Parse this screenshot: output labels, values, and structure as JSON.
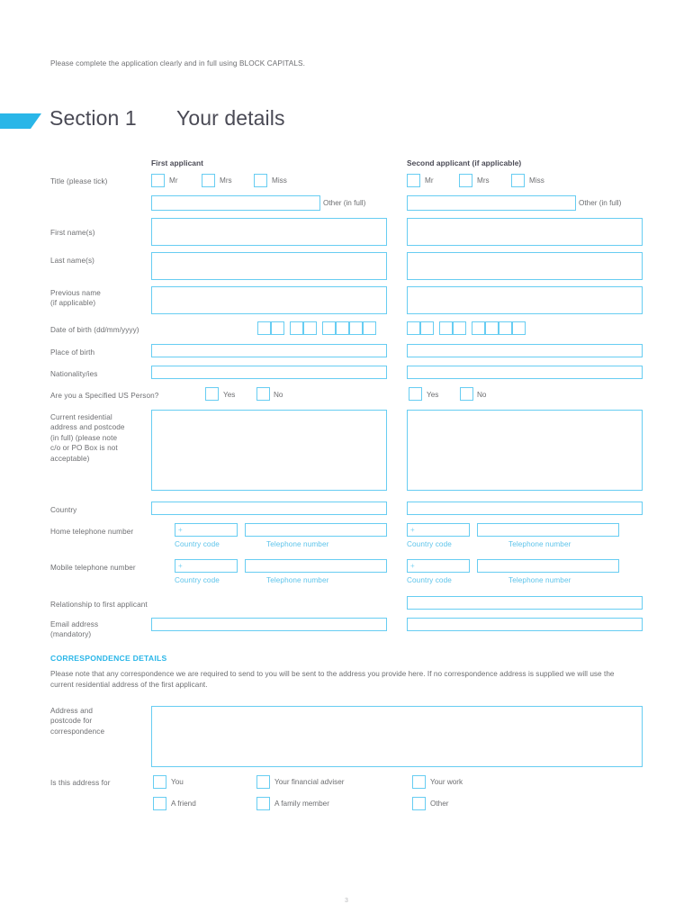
{
  "intro": {
    "text": "Please complete the application clearly and in full using BLOCK CAPITALS."
  },
  "section": {
    "number_label": "Section 1",
    "title": "Your details",
    "accent_color": "#29b6e8"
  },
  "colors": {
    "accent": "#29b6e8",
    "field_border": "#67cdf2",
    "sub_label": "#5cc3ea",
    "body_text": "#6d6e71",
    "heading_text": "#4a4a55"
  },
  "columns": {
    "first": "First applicant",
    "second": "Second applicant (if applicable)"
  },
  "rows": {
    "title": {
      "label": "Title (please tick)",
      "options": [
        "Mr",
        "Mrs",
        "Miss"
      ],
      "other_label": "Other (in full)",
      "first_value": "",
      "second_value": ""
    },
    "first_names": {
      "label": "First name(s)",
      "first_value": "",
      "second_value": ""
    },
    "last_names": {
      "label": "Last name(s)",
      "first_value": "",
      "second_value": ""
    },
    "previous_name": {
      "label": "Previous name\n(if applicable)",
      "first_value": "",
      "second_value": ""
    },
    "date_of_birth": {
      "label": "Date of birth (dd/mm/yyyy)",
      "groups": [
        2,
        2,
        4
      ],
      "first_value": "",
      "second_value": ""
    },
    "place_of_birth": {
      "label": "Place of birth",
      "first_value": "",
      "second_value": ""
    },
    "nationality": {
      "label": "Nationality/ies",
      "first_value": "",
      "second_value": ""
    },
    "us_person": {
      "label": "Are you a Specified US Person?",
      "options": [
        "Yes",
        "No"
      ]
    },
    "residential_address": {
      "label": "Current residential\naddress and postcode\n(in full) (please note\nc/o or PO Box is not\nacceptable)",
      "first_value": "",
      "second_value": ""
    },
    "country": {
      "label": "Country",
      "first_value": "",
      "second_value": ""
    },
    "home_phone": {
      "label": "Home telephone number",
      "country_code_prefix": "+",
      "country_code_sub": "Country code",
      "number_sub": "Telephone number",
      "first_code": "",
      "first_number": "",
      "second_code": "",
      "second_number": ""
    },
    "mobile_phone": {
      "label": "Mobile telephone number",
      "country_code_prefix": "+",
      "country_code_sub": "Country code",
      "number_sub": "Telephone number",
      "first_code": "",
      "first_number": "",
      "second_code": "",
      "second_number": ""
    },
    "relationship": {
      "label": "Relationship to first applicant",
      "second_value": ""
    },
    "email": {
      "label": "Email address\n(mandatory)",
      "first_value": "",
      "second_value": ""
    }
  },
  "correspondence": {
    "heading": "CORRESPONDENCE DETAILS",
    "note": "Please note that any correspondence we are required to send to you will be sent to the address you provide here. If no correspondence address is supplied we will use the current residential address of the first applicant.",
    "address_label": "Address and\npostcode for\ncorrespondence",
    "address_value": "",
    "is_address_for_label": "Is this address for",
    "options_row1": [
      "You",
      "Your financial adviser",
      "Your work"
    ],
    "options_row2": [
      "A friend",
      "A family member",
      "Other"
    ]
  },
  "footer": {
    "page_number": "3"
  }
}
